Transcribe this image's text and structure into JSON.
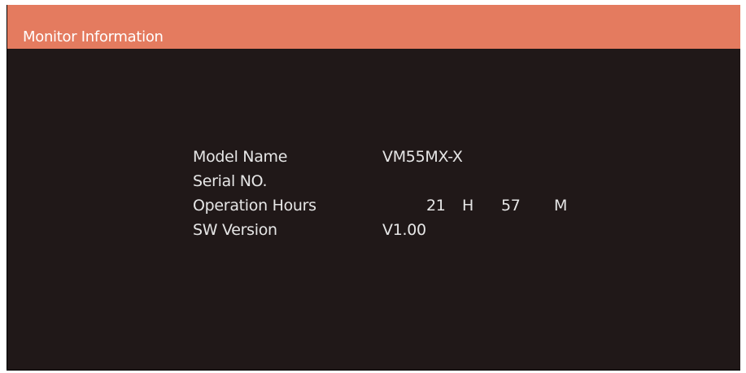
{
  "header": {
    "title": "Monitor Information"
  },
  "info": {
    "model_name": {
      "label": "Model Name",
      "value": "VM55MX-X"
    },
    "serial_no": {
      "label": "Serial NO.",
      "value": ""
    },
    "operation_hours": {
      "label": "Operation Hours",
      "hours": "21",
      "hours_unit": "H",
      "minutes": "57",
      "minutes_unit": "M"
    },
    "sw_version": {
      "label": "SW Version",
      "value": "V1.00"
    }
  },
  "colors": {
    "header_bg": "#e47b5f",
    "panel_bg": "#201818",
    "text": "#e6e6e6"
  }
}
